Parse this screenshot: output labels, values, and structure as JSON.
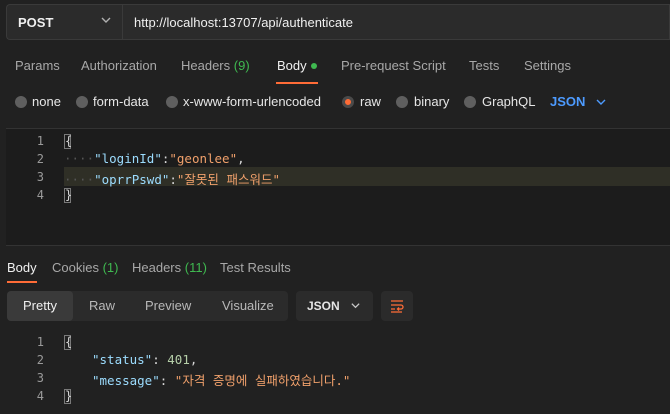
{
  "request": {
    "method": "POST",
    "url": "http://localhost:13707/api/authenticate",
    "tabs": [
      {
        "label": "Params"
      },
      {
        "label": "Authorization"
      },
      {
        "label": "Headers",
        "count": "(9)"
      },
      {
        "label": "Body"
      },
      {
        "label": "Pre-request Script"
      },
      {
        "label": "Tests"
      },
      {
        "label": "Settings"
      }
    ],
    "active_tab": "Body",
    "body_types": [
      "none",
      "form-data",
      "x-www-form-urlencoded",
      "raw",
      "binary",
      "GraphQL"
    ],
    "selected_body_type": "raw",
    "format": "JSON",
    "editor_lines": {
      "numbers": [
        "1",
        "2",
        "3",
        "4"
      ],
      "open": "{",
      "close": "}",
      "line2_key": "\"loginId\"",
      "line2_value": "\"geonlee\"",
      "line3_key": "\"oprrPswd\"",
      "line3_value": "\"잘못된 패스워드\""
    }
  },
  "response": {
    "tabs": [
      {
        "label": "Body"
      },
      {
        "label": "Cookies",
        "count": "(1)"
      },
      {
        "label": "Headers",
        "count": "(11)"
      },
      {
        "label": "Test Results"
      }
    ],
    "active_tab": "Body",
    "views": [
      "Pretty",
      "Raw",
      "Preview",
      "Visualize"
    ],
    "active_view": "Pretty",
    "format": "JSON",
    "editor_lines": {
      "numbers": [
        "1",
        "2",
        "3",
        "4"
      ],
      "open": "{",
      "close": "}",
      "line2_key": "\"status\"",
      "line2_value": "401",
      "line3_key": "\"message\"",
      "line3_value": "\"자격 증명에 실패하였습니다.\""
    }
  },
  "colors": {
    "accent": "#ff6c37",
    "count": "#3fb950",
    "link": "#4d9bff",
    "background": "#212121"
  },
  "icons": [
    "chevron-down-icon",
    "wrap-lines-icon"
  ]
}
